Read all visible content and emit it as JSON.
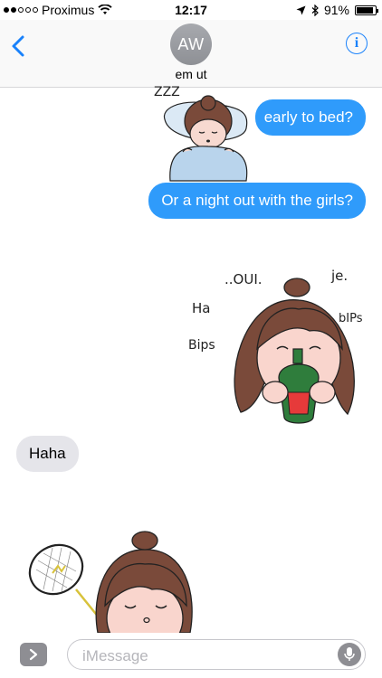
{
  "status_bar": {
    "carrier": "Proximus",
    "signal_dots": 5,
    "signal_filled": 2,
    "time": "12:17",
    "battery_percent": "91%",
    "battery_level": 0.91,
    "icons": [
      "wifi-icon",
      "location-arrow-icon",
      "bluetooth-icon",
      "battery-icon"
    ]
  },
  "header": {
    "back_icon": "chevron-left-icon",
    "avatar_initials": "AW",
    "contact_name": "em ut",
    "info_icon": "info-icon",
    "info_glyph": "i"
  },
  "messages": [
    {
      "side": "right",
      "type": "text",
      "text": "early to bed?"
    },
    {
      "side": "right",
      "type": "text",
      "text": "Or a night out with the girls?"
    },
    {
      "side": "right",
      "type": "sticker",
      "name": "girl-with-drink-sticker",
      "doodles": [
        "..OUI.",
        "je.",
        "Ha",
        "bIPs",
        "Bips"
      ]
    },
    {
      "side": "left",
      "type": "text",
      "text": "Haha"
    },
    {
      "side": "left",
      "type": "sticker",
      "name": "girl-with-racket-sticker"
    }
  ],
  "sleeping_sticker": {
    "name": "sleeping-girl-sticker",
    "zzz": "ZZZ"
  },
  "input_bar": {
    "expand_icon": "chevron-right-icon",
    "placeholder": "iMessage",
    "value": "",
    "mic_icon": "microphone-icon"
  },
  "colors": {
    "accent_blue": "#1a82fb",
    "bubble_blue": "#2f9bfb",
    "bubble_gray": "#e5e5ea",
    "avatar_gray": "#9a9ca1"
  }
}
